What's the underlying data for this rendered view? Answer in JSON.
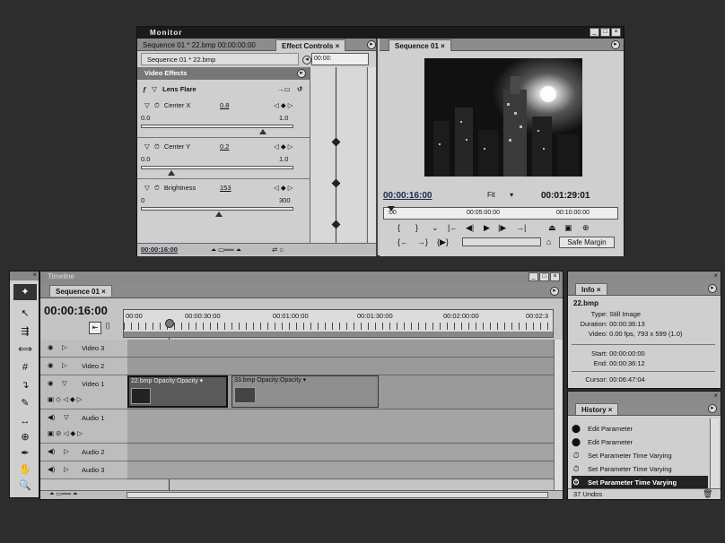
{
  "monitor": {
    "title": "Monitor",
    "tabs": [
      "Sequence 01 * 22.bmp  00:00:00:00",
      "Effect Controls",
      "Sequence 01"
    ],
    "effect_controls": {
      "header": "Sequence 01 * 22.bmp",
      "ruler_time": "00:00:",
      "section_video_effects": "Video Effects",
      "effect_name": "Lens Flare",
      "params": [
        {
          "name": "Center X",
          "value": "0.8",
          "min": "0.0",
          "max": "1.0",
          "level": 0.8
        },
        {
          "name": "Center Y",
          "value": "0.2",
          "min": "0.0",
          "max": "1.0",
          "level": 0.2
        },
        {
          "name": "Brightness",
          "value": "153",
          "min": "0",
          "max": "300",
          "level": 0.51
        }
      ],
      "current_time": "00:00:16:00"
    },
    "program": {
      "current_time": "00:00:16:00",
      "fit_label": "Fit",
      "duration": "00:01:29:01",
      "ruler_labels": [
        ":00",
        "00:05:00:00",
        "00:10:00:00"
      ],
      "safe_margins_label": "Safe Margin"
    }
  },
  "timeline": {
    "title": "Timeline",
    "tab": "Sequence 01",
    "current_time": "00:00:16:00",
    "ruler_labels": [
      "00:00",
      "00:00:30:00",
      "00:01:00:00",
      "00:01:30:00",
      "00:02:00:00",
      "00:02:3"
    ],
    "tracks": [
      {
        "name": "Video 3",
        "type": "video"
      },
      {
        "name": "Video 2",
        "type": "video"
      },
      {
        "name": "Video 1",
        "type": "video"
      },
      {
        "name": "Audio 1",
        "type": "audio"
      },
      {
        "name": "Audio 2",
        "type": "audio"
      },
      {
        "name": "Audio 3",
        "type": "audio"
      }
    ],
    "clips": [
      {
        "label": "22.bmp Opacity:Opacity ▾"
      },
      {
        "label": "33.bmp Opacity:Opacity ▾"
      }
    ]
  },
  "tools": [
    "arrow",
    "track-select",
    "ripple",
    "rolling",
    "rate-stretch",
    "razor",
    "slip",
    "slide",
    "pen",
    "hand",
    "zoom"
  ],
  "info": {
    "tab": "Info",
    "clip": "22.bmp",
    "type_label": "Type:",
    "type_value": "Still Image",
    "duration_label": "Duration:",
    "duration_value": "00:00:36:13",
    "video_label": "Video:",
    "video_value": "0.00 fps, 793 x 599 (1.0)",
    "start_label": "Start:",
    "start_value": "00:00:00:00",
    "end_label": "End:",
    "end_value": "00:00:36:12",
    "cursor_label": "Cursor:",
    "cursor_value": "00:06:47:04"
  },
  "history": {
    "tab": "History",
    "items": [
      {
        "label": "Edit Parameter",
        "icon": "edit-parameter-icon"
      },
      {
        "label": "Edit Parameter",
        "icon": "edit-parameter-icon"
      },
      {
        "label": "Set Parameter Time Varying",
        "icon": "stopwatch-icon"
      },
      {
        "label": "Set Parameter Time Varying",
        "icon": "stopwatch-icon"
      },
      {
        "label": "Set Parameter Time Varying",
        "icon": "stopwatch-icon"
      }
    ],
    "undos": "37 Undos"
  }
}
